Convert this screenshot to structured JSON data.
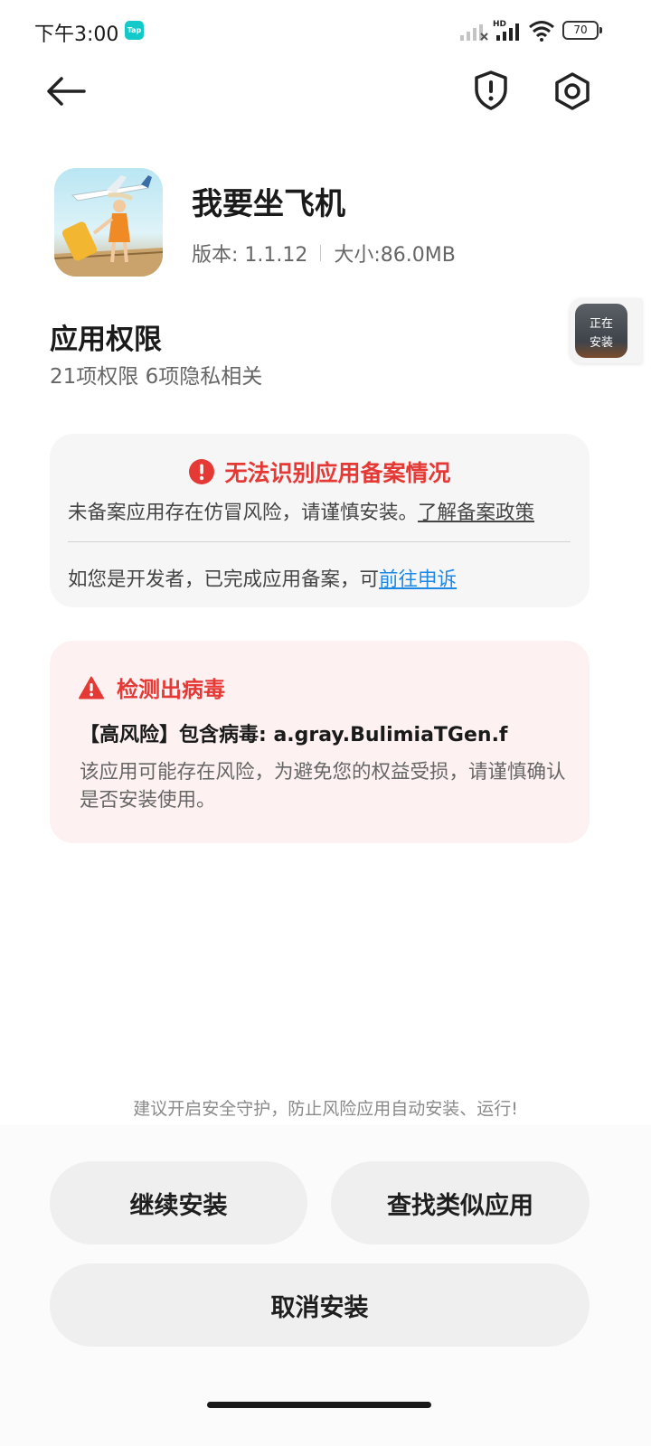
{
  "status_bar": {
    "time": "下午3:00",
    "tap_badge": "Tap",
    "network_tag": "HD",
    "battery": "70",
    "icons": [
      "signal-crossed-icon",
      "signal-hd-icon",
      "wifi-icon",
      "battery-icon"
    ]
  },
  "top_bar": {
    "icons": [
      "back-arrow-icon",
      "shield-alert-icon",
      "settings-hexagon-icon"
    ]
  },
  "app": {
    "name": "我要坐飞机",
    "version": "版本: 1.1.12",
    "size": "大小:86.0MB"
  },
  "installing": {
    "line1": "正在",
    "line2": "安装"
  },
  "permissions": {
    "title": "应用权限",
    "summary": "21项权限 6项隐私相关"
  },
  "record_notice": {
    "title": "无法识别应用备案情况",
    "description": "未备案应用存在仿冒风险，请谨慎安装。",
    "policy_link": "了解备案政策",
    "developer_text": "如您是开发者，已完成应用备案，可",
    "appeal_link": "前往申诉"
  },
  "virus_notice": {
    "title": "检测出病毒",
    "virus_name": "【高风险】包含病毒: a.gray.BulimiaTGen.f",
    "description": "该应用可能存在风险，为避免您的权益受损，请谨慎确认是否安装使用。"
  },
  "bottom": {
    "tip": "建议开启安全守护，防止风险应用自动安装、运行!",
    "continue_label": "继续安装",
    "find_similar_label": "查找类似应用",
    "cancel_label": "取消安装"
  },
  "colors": {
    "danger": "#e53935",
    "link": "#1e88e5",
    "button_bg": "#efefef",
    "virus_card_bg": "#fdf1f1",
    "record_card_bg": "#f6f6f6"
  }
}
